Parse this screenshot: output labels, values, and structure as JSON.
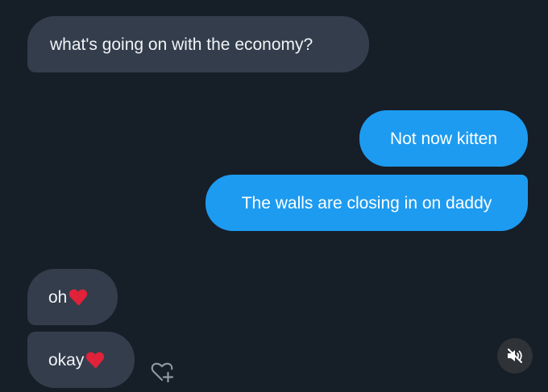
{
  "messages": [
    {
      "text": "what's going on with the economy?",
      "sender": "other"
    },
    {
      "text": "Not now kitten",
      "sender": "me"
    },
    {
      "text": "The walls are closing in on daddy",
      "sender": "me"
    },
    {
      "text": "oh",
      "emoji": "broken-heart-icon",
      "sender": "other"
    },
    {
      "text": "okay",
      "emoji": "broken-heart-icon",
      "sender": "other"
    }
  ],
  "controls": {
    "react_icon": "heart-plus-icon",
    "mute_icon": "speaker-muted-icon"
  },
  "colors": {
    "background": "#161e27",
    "received_bubble": "#333d4b",
    "sent_bubble": "#1d9bf0",
    "broken_heart": "#e0223a"
  }
}
